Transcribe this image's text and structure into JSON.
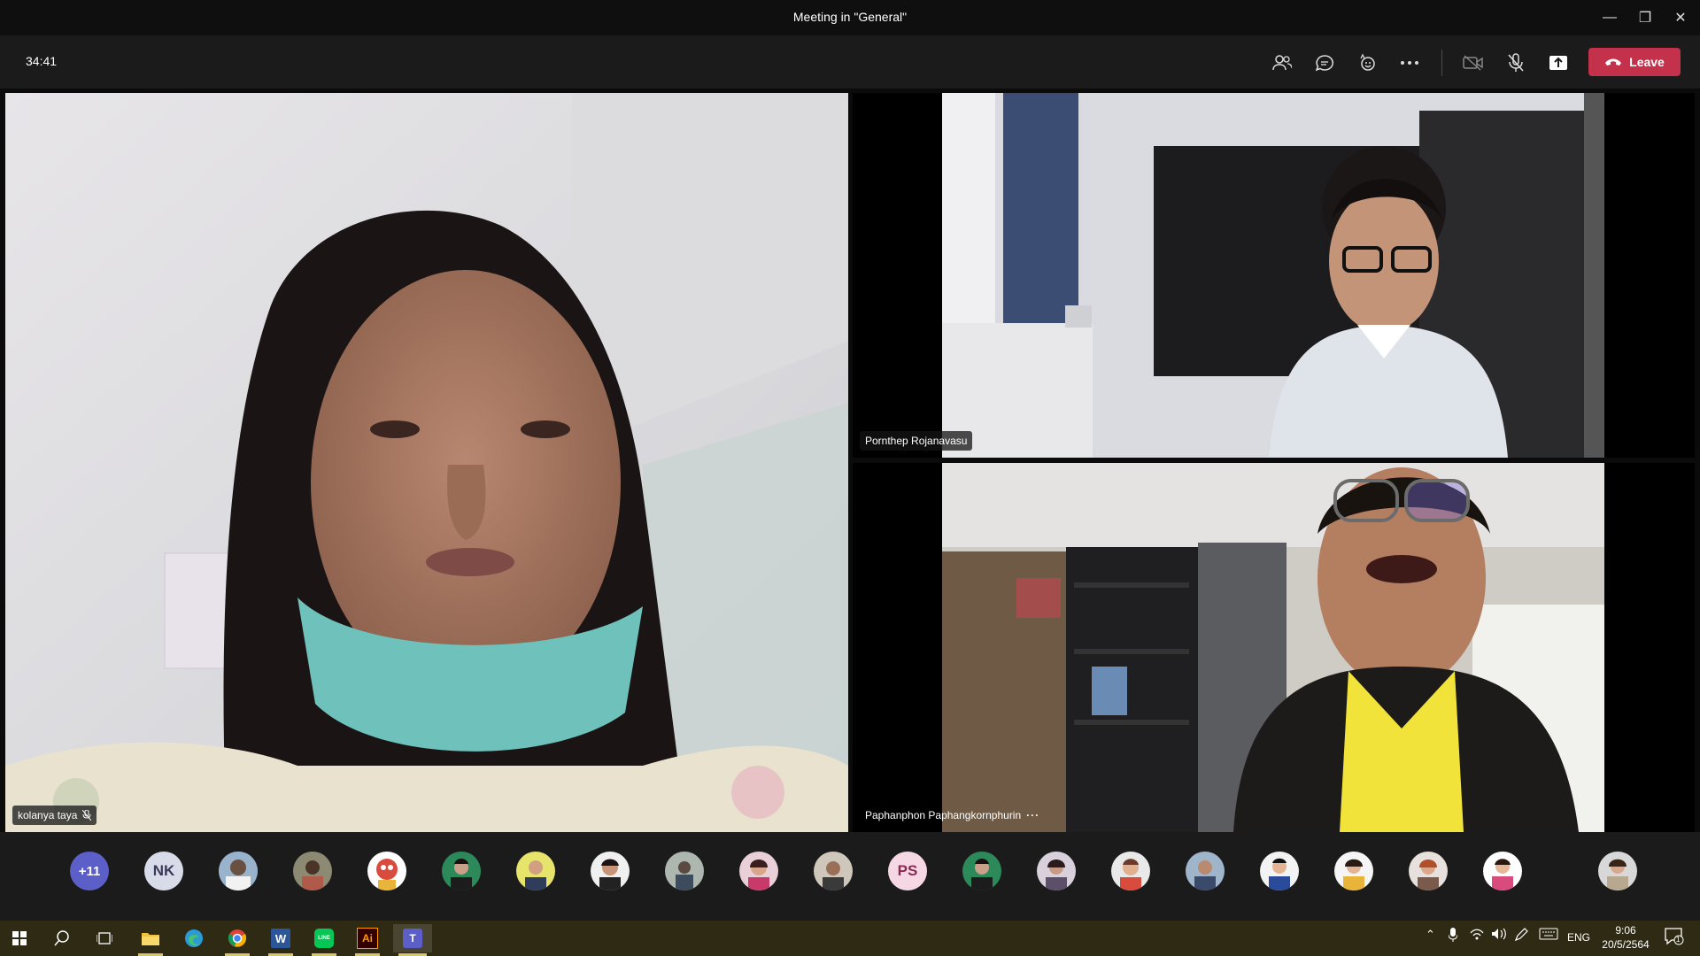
{
  "window": {
    "title": "Meeting in \"General\"",
    "minimize_glyph": "—",
    "restore_glyph": "❐",
    "close_glyph": "✕"
  },
  "toolbar": {
    "timer": "34:41",
    "buttons": [
      "people-icon",
      "chat-icon",
      "reactions-icon",
      "more-options-icon",
      "camera-off-icon",
      "mic-off-icon",
      "share-screen-icon"
    ],
    "leave_label": "Leave",
    "leave_color": "#c4314b"
  },
  "participants_videos": [
    {
      "name": "kolanya taya",
      "muted": true
    },
    {
      "name": "Pornthep Rojanavasu"
    },
    {
      "name": "Paphanphon Paphangkornphurin",
      "more": "···"
    }
  ],
  "roster": {
    "overflow_label": "+11",
    "initials_1": "NK",
    "initials_2": "PS"
  },
  "taskbar": {
    "apps": [
      "windows-start-icon",
      "search-icon",
      "task-view-icon",
      "file-explorer-icon",
      "edge-icon",
      "chrome-icon",
      "word-icon",
      "line-icon",
      "illustrator-icon",
      "teams-icon"
    ],
    "illustrator_label": "Ai",
    "word_label": "W",
    "teams_label": "T",
    "line_label": "LINE",
    "language": "ENG",
    "time": "9:06",
    "date": "20/5/2564",
    "notification_count": "1"
  }
}
